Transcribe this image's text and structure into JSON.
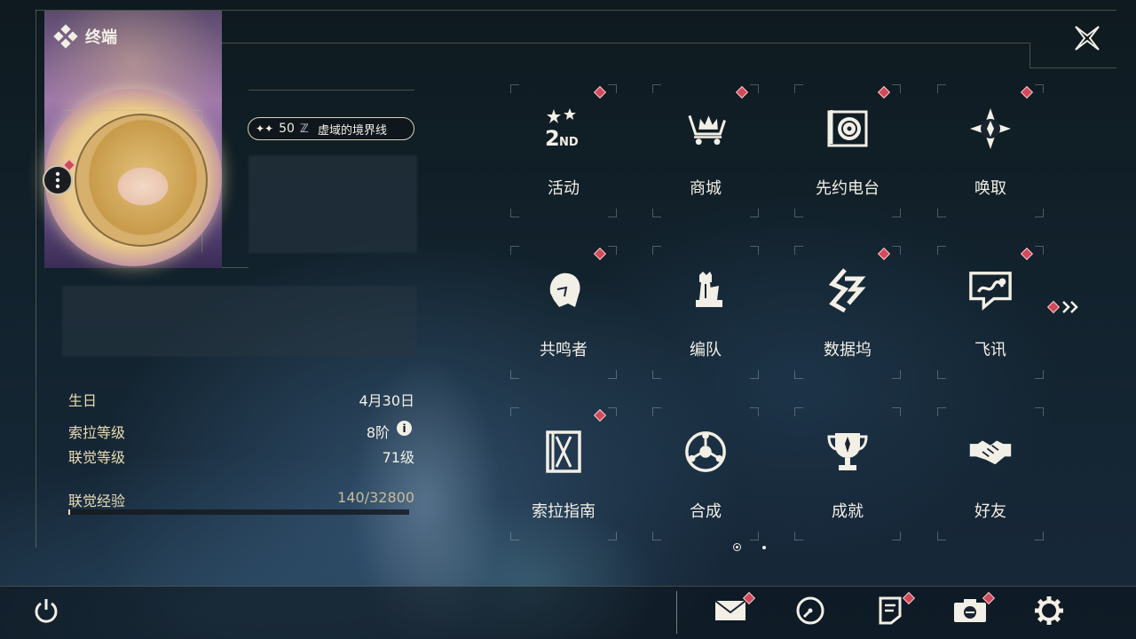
{
  "header": {
    "title": "终端"
  },
  "profile": {
    "level": "50",
    "world_name": "虚域的境界线"
  },
  "stats": [
    {
      "label": "生日",
      "value": "4月30日"
    },
    {
      "label": "索拉等级",
      "value": "8阶"
    },
    {
      "label": "联觉等级",
      "value": "71级"
    },
    {
      "label": "联觉经验",
      "value": "140/32800"
    }
  ],
  "exp_progress": 0.0043,
  "menu": [
    {
      "label": "活动",
      "icon": "event-2nd-icon",
      "badge": true
    },
    {
      "label": "商城",
      "icon": "shop-cart-crown-icon",
      "badge": true
    },
    {
      "label": "先约电台",
      "icon": "radio-icon",
      "badge": true
    },
    {
      "label": "唤取",
      "icon": "gacha-compass-icon",
      "badge": true
    },
    {
      "label": "共鸣者",
      "icon": "resonator-head-icon",
      "badge": true
    },
    {
      "label": "编队",
      "icon": "chess-team-icon",
      "badge": false
    },
    {
      "label": "数据坞",
      "icon": "data-dock-icon",
      "badge": true
    },
    {
      "label": "飞讯",
      "icon": "message-chat-icon",
      "badge": true
    },
    {
      "label": "索拉指南",
      "icon": "guidebook-icon",
      "badge": true
    },
    {
      "label": "合成",
      "icon": "synthesis-icon",
      "badge": false
    },
    {
      "label": "成就",
      "icon": "trophy-icon",
      "badge": false
    },
    {
      "label": "好友",
      "icon": "handshake-icon",
      "badge": false
    }
  ],
  "colors": {
    "badge": "#d24a5a",
    "accent_text": "#e9dcb4"
  },
  "bottom_bar": [
    {
      "name": "mail",
      "icon": "mail-icon",
      "badge": true
    },
    {
      "name": "clock",
      "icon": "clock-icon",
      "badge": false
    },
    {
      "name": "notes",
      "icon": "notes-icon",
      "badge": true
    },
    {
      "name": "camera",
      "icon": "camera-icon",
      "badge": true
    },
    {
      "name": "settings",
      "icon": "gear-icon",
      "badge": false
    }
  ]
}
